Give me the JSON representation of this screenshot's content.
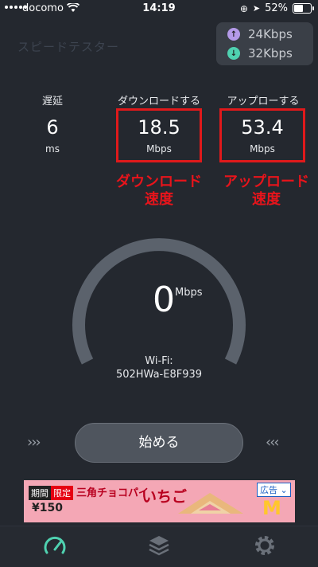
{
  "status": {
    "carrier": "docomo",
    "time": "14:19",
    "battery": "52%"
  },
  "app": {
    "title": "スピードテスター"
  },
  "network": {
    "upload_rate": "24Kbps",
    "download_rate": "32Kbps"
  },
  "stats": {
    "latency": {
      "label": "遅延",
      "value": "6",
      "unit": "ms"
    },
    "download": {
      "label": "ダウンロードする",
      "value": "18.5",
      "unit": "Mbps"
    },
    "upload": {
      "label": "アップローする",
      "value": "53.4",
      "unit": "Mbps"
    }
  },
  "annotations": {
    "download": [
      "ダウンロード",
      "速度"
    ],
    "upload": [
      "アップロード",
      "速度"
    ]
  },
  "gauge": {
    "value": "0",
    "unit": "Mbps",
    "wifi_label": "Wi-Fi:",
    "ssid": "502HWa-E8F939"
  },
  "start_button": "始める",
  "ad": {
    "tag1": "期間",
    "tag2": "限定",
    "line1": "三角チョコパイ",
    "line2": "いちご",
    "price": "¥150",
    "badge": "広告",
    "brand": "M"
  },
  "tabs": [
    {
      "icon": "speedometer-icon"
    },
    {
      "icon": "layers-icon"
    },
    {
      "icon": "gear-icon"
    }
  ],
  "colors": {
    "background": "#24282f",
    "annotation_red": "#e0191b",
    "accent_green": "#4fd1b0"
  }
}
